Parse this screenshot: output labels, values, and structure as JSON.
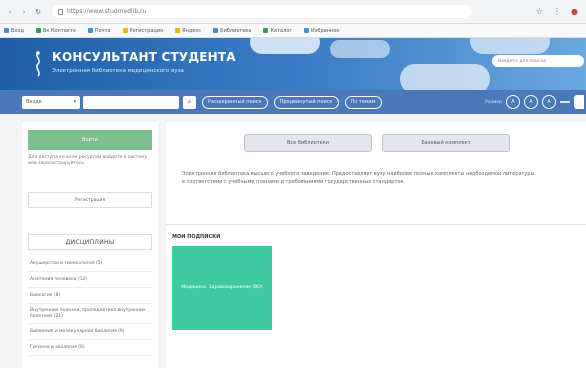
{
  "browser": {
    "url": "https://www.studmedlib.ru",
    "bookmarks": [
      "Вход",
      "Вк Контакте",
      "Почта",
      "Регистрация",
      "Яндекс",
      "Библиотека",
      "Каталог",
      "Избранное"
    ]
  },
  "header": {
    "brand_title": "КОНСУЛЬТАНТ СТУДЕНТА",
    "brand_subtitle": "Электронная библиотека медицинского вуза",
    "search_placeholder": "Введите для поиска"
  },
  "toolbar": {
    "select_value": "Везде",
    "pill_1": "Расширенный поиск",
    "pill_2": "Продвинутый поиск",
    "pill_3": "По темам",
    "font_label": "Размер",
    "font_a1": "A",
    "font_a2": "A",
    "font_a3": "A"
  },
  "sidebar": {
    "green_button": "Войти",
    "note": "Для доступа ко всем ресурсам войдите в систему или зарегистрируйтесь",
    "secondary_button": "Регистрация",
    "disciplines_title": "ДИСЦИПЛИНЫ",
    "disciplines": [
      "Акушерство и гинекология (5)",
      "Анатомия человека (12)",
      "Биология (8)",
      "Внутренние болезни, пропедевтика внутренних болезней (21)",
      "Биохимия и молекулярная биология (9)",
      "Гигиена и экология (6)"
    ]
  },
  "main": {
    "tab_all": "Все библиотеки",
    "tab_basic": "Базовый комплект",
    "description": "Электронная библиотека высшего учебного заведения. Предоставляет вузу наиболее полные комплекты необходимой литературы в соответствии с учебными планами и требованиями государственных стандартов.",
    "subs_title": "МОИ ПОДПИСКИ",
    "sub_card": "Медицина. Здравоохранение (ВО)"
  },
  "colors": {
    "hero": "#2f6fb8",
    "toolbar": "#4a78b8",
    "green": "#7dc08e",
    "teal": "#3ec9a0"
  }
}
